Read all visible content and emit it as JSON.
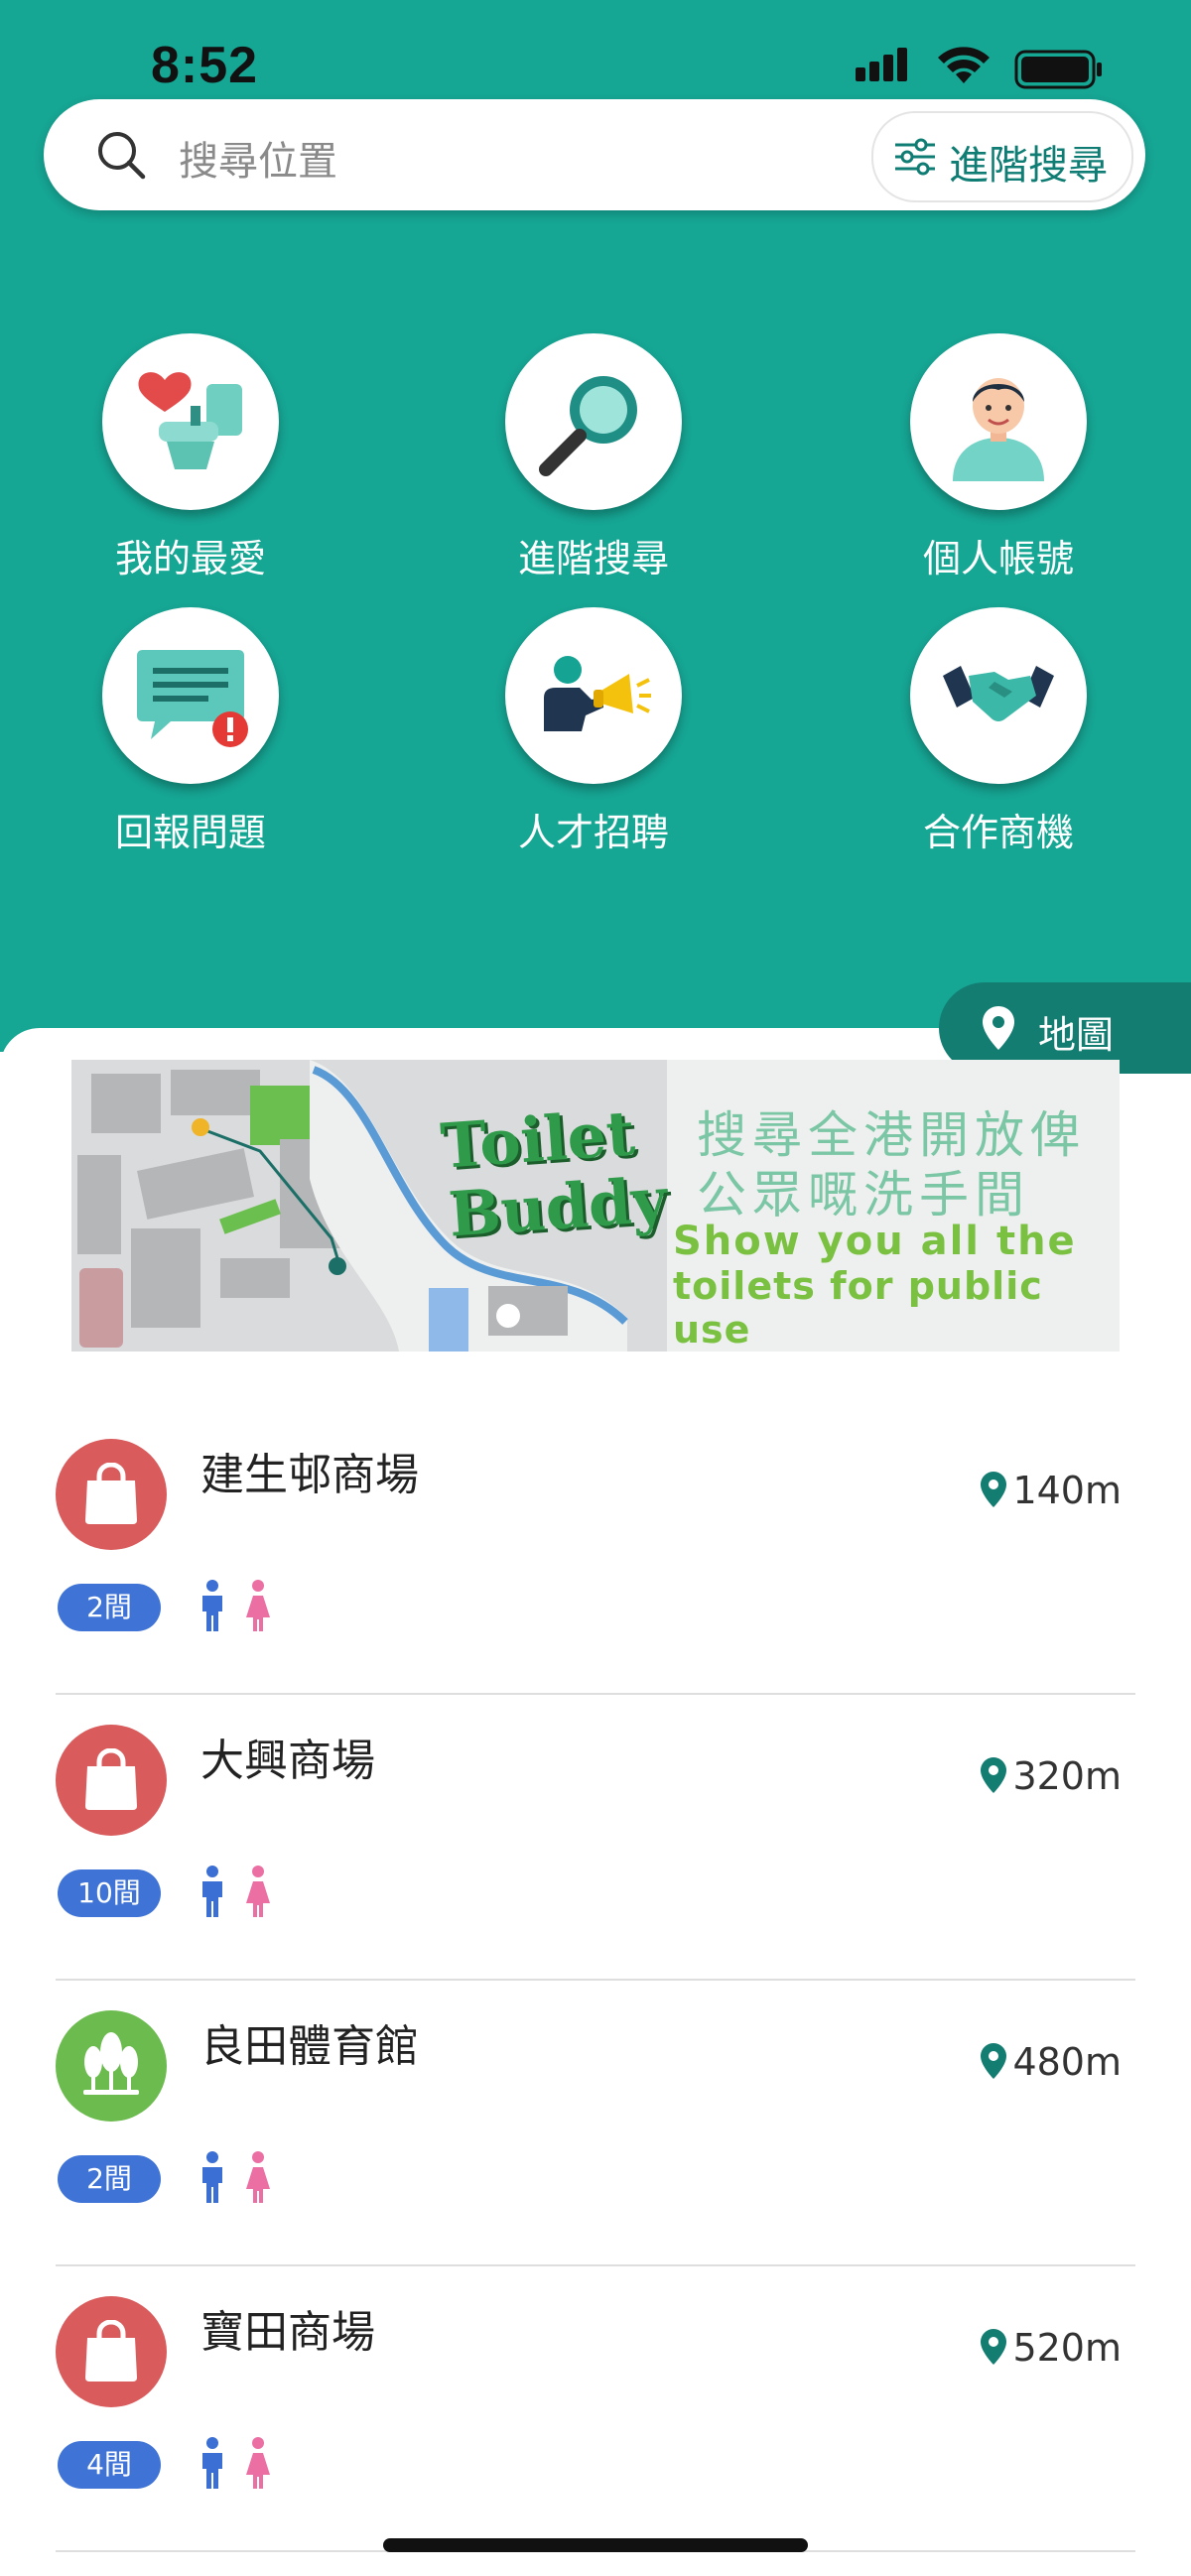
{
  "status_bar": {
    "time": "8:52"
  },
  "search": {
    "placeholder": "搜尋位置",
    "advanced_label": "進階搜尋"
  },
  "shortcuts": [
    {
      "label": "我的最愛",
      "icon": "toilet-heart-icon"
    },
    {
      "label": "進階搜尋",
      "icon": "magnifier-icon"
    },
    {
      "label": "個人帳號",
      "icon": "person-avatar-icon"
    },
    {
      "label": "回報問題",
      "icon": "chat-alert-icon"
    },
    {
      "label": "人才招聘",
      "icon": "megaphone-recruit-icon"
    },
    {
      "label": "合作商機",
      "icon": "handshake-icon"
    }
  ],
  "map_button": {
    "label": "地圖"
  },
  "banner": {
    "logo_line1": "Toilet",
    "logo_line2": "Buddy",
    "cn_line1": "搜尋全港開放俾",
    "cn_line2": "公眾嘅洗手間",
    "en_line1": "Show you all the",
    "en_line2": "toilets for public use"
  },
  "colors": {
    "teal": "#16a694",
    "dark_teal": "#137d72",
    "mall_red": "#d95b5c",
    "park_green": "#6cbb4e",
    "count_blue": "#3f74d6",
    "male_blue": "#3b6fd4",
    "female_pink": "#ec6fa4"
  },
  "places": [
    {
      "name": "建生邨商場",
      "distance": "140m",
      "count": "2間",
      "type": "mall"
    },
    {
      "name": "大興商場",
      "distance": "320m",
      "count": "10間",
      "type": "mall"
    },
    {
      "name": "良田體育館",
      "distance": "480m",
      "count": "2間",
      "type": "park"
    },
    {
      "name": "寶田商場",
      "distance": "520m",
      "count": "4間",
      "type": "mall"
    }
  ]
}
